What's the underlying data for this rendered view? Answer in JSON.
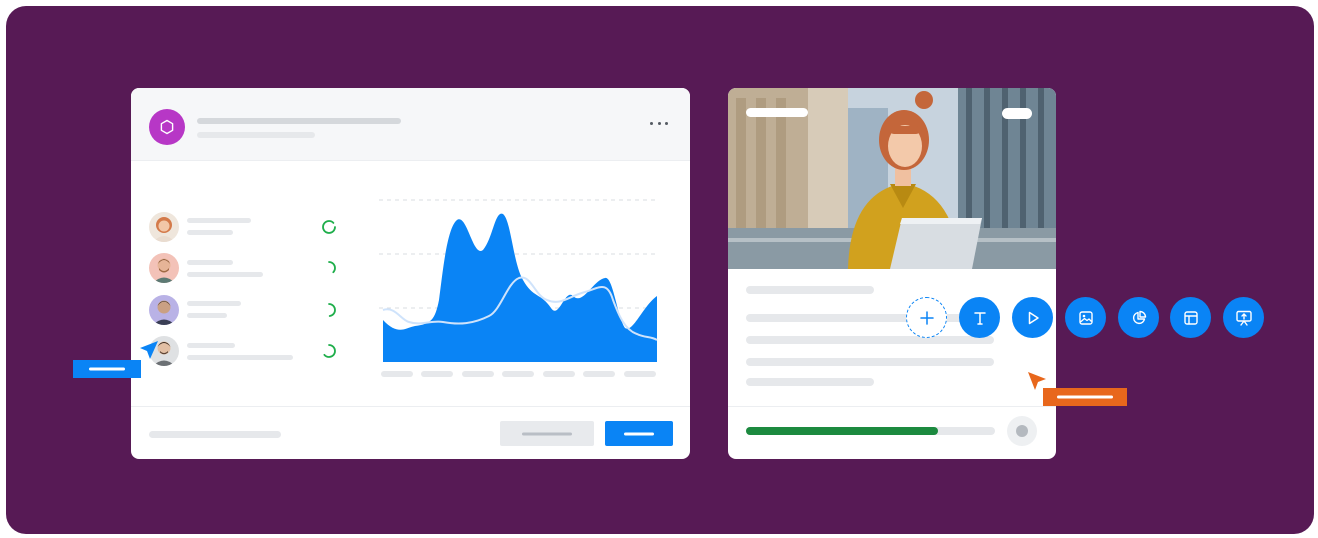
{
  "colors": {
    "background": "#571a55",
    "accent": "#0a84f5",
    "brand": "#b737c6",
    "progress": "#1c8a3f",
    "cursor_orange": "#e8671c"
  },
  "dashboard": {
    "logo_icon": "hexagon-icon",
    "menu_icon": "more-dots-icon",
    "people": [
      {
        "avatar": "woman-red-hair-avatar",
        "status": "ring-complete"
      },
      {
        "avatar": "man-bearded-avatar",
        "status": "ring-partial"
      },
      {
        "avatar": "man-dark-hair-avatar",
        "status": "ring-partial"
      },
      {
        "avatar": "man-grey-shirt-avatar",
        "status": "ring-complete"
      }
    ]
  },
  "media_card": {
    "photo_subject": "woman-with-laptop-photo",
    "progress_fraction": 0.77
  },
  "tools": [
    {
      "name": "add-tool",
      "icon": "plus-icon"
    },
    {
      "name": "text-tool",
      "icon": "text-icon"
    },
    {
      "name": "video-tool",
      "icon": "play-icon"
    },
    {
      "name": "image-tool",
      "icon": "image-icon"
    },
    {
      "name": "chart-tool",
      "icon": "pie-chart-icon"
    },
    {
      "name": "layout-tool",
      "icon": "layout-icon"
    },
    {
      "name": "presentation-tool",
      "icon": "presentation-icon"
    }
  ]
}
